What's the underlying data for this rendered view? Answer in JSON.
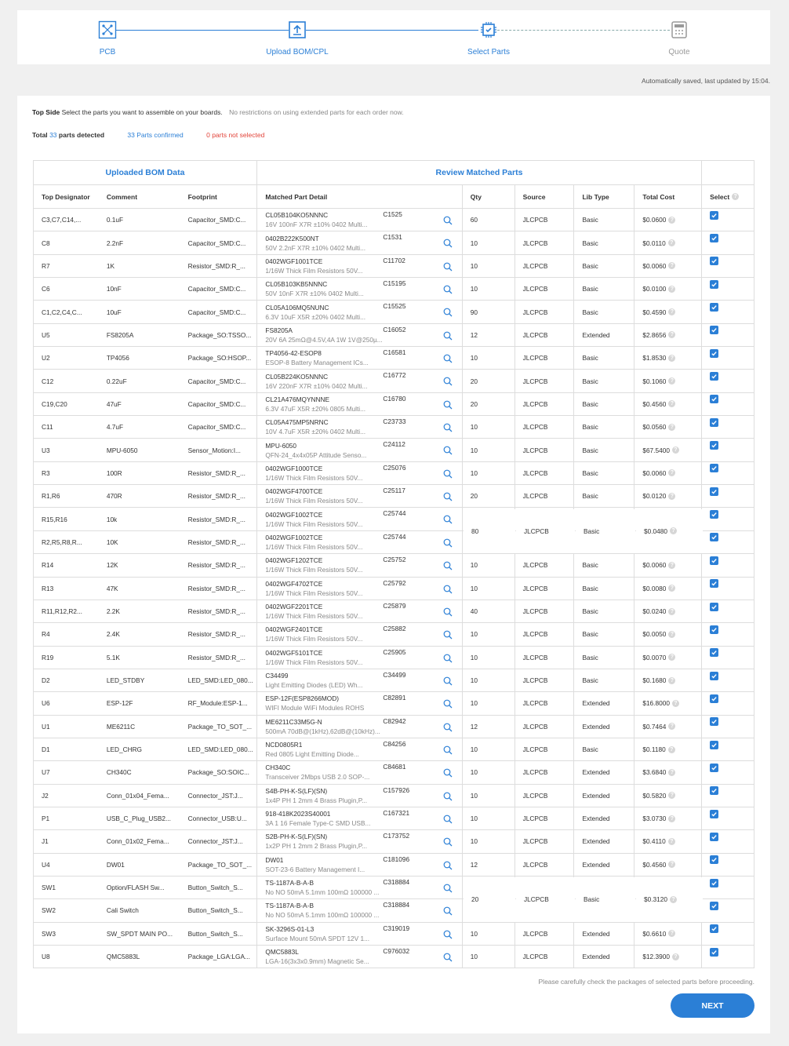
{
  "stepper": {
    "steps": [
      {
        "label": "PCB",
        "icon": "pcb-icon"
      },
      {
        "label": "Upload BOM/CPL",
        "icon": "upload-icon"
      },
      {
        "label": "Select Parts",
        "icon": "chip-icon"
      },
      {
        "label": "Quote",
        "icon": "calculator-icon"
      }
    ]
  },
  "autosave": "Automatically saved, last updated by 15:04.",
  "info": {
    "side": "Top Side",
    "instruction": "Select the parts you want to assemble on your boards.",
    "note": "No restrictions on using extended parts for each order now.",
    "total_prefix": "Total",
    "total_count": "33",
    "total_suffix": "parts detected",
    "confirmed": "33 Parts confirmed",
    "not_selected": "0 parts not selected"
  },
  "table": {
    "group_left": "Uploaded BOM Data",
    "group_right": "Review Matched Parts",
    "headers": {
      "designator": "Top Designator",
      "comment": "Comment",
      "footprint": "Footprint",
      "matched": "Matched Part Detail",
      "qty": "Qty",
      "source": "Source",
      "lib_type": "Lib Type",
      "total_cost": "Total Cost",
      "select": "Select"
    },
    "rows": [
      {
        "des": "C3,C7,C14,...",
        "comment": "0.1uF",
        "fp": "Capacitor_SMD:C...",
        "pn": "CL05B104KO5NNNC",
        "lcsc": "C1525",
        "desc": "16V 100nF X7R ±10% 0402 Multi...",
        "qty": "60",
        "source": "JLCPCB",
        "lib": "Basic",
        "cost": "$0.0600"
      },
      {
        "des": "C8",
        "comment": "2.2nF",
        "fp": "Capacitor_SMD:C...",
        "pn": "0402B222K500NT",
        "lcsc": "C1531",
        "desc": "50V 2.2nF X7R ±10% 0402 Multi...",
        "qty": "10",
        "source": "JLCPCB",
        "lib": "Basic",
        "cost": "$0.0110"
      },
      {
        "des": "R7",
        "comment": "1K",
        "fp": "Resistor_SMD:R_...",
        "pn": "0402WGF1001TCE",
        "lcsc": "C11702",
        "desc": "1/16W Thick Film Resistors 50V...",
        "qty": "10",
        "source": "JLCPCB",
        "lib": "Basic",
        "cost": "$0.0060"
      },
      {
        "des": "C6",
        "comment": "10nF",
        "fp": "Capacitor_SMD:C...",
        "pn": "CL05B103KB5NNNC",
        "lcsc": "C15195",
        "desc": "50V 10nF X7R ±10% 0402 Multi...",
        "qty": "10",
        "source": "JLCPCB",
        "lib": "Basic",
        "cost": "$0.0100"
      },
      {
        "des": "C1,C2,C4,C...",
        "comment": "10uF",
        "fp": "Capacitor_SMD:C...",
        "pn": "CL05A106MQ5NUNC",
        "lcsc": "C15525",
        "desc": "6.3V 10uF X5R ±20% 0402 Multi...",
        "qty": "90",
        "source": "JLCPCB",
        "lib": "Basic",
        "cost": "$0.4590"
      },
      {
        "des": "U5",
        "comment": "FS8205A",
        "fp": "Package_SO:TSSO...",
        "pn": "FS8205A",
        "lcsc": "C16052",
        "desc": "20V 6A 25mΩ@4.5V,4A 1W 1V@250µ...",
        "qty": "12",
        "source": "JLCPCB",
        "lib": "Extended",
        "cost": "$2.8656"
      },
      {
        "des": "U2",
        "comment": "TP4056",
        "fp": "Package_SO:HSOP...",
        "pn": "TP4056-42-ESOP8",
        "lcsc": "C16581",
        "desc": "ESOP-8 Battery Management ICs...",
        "qty": "10",
        "source": "JLCPCB",
        "lib": "Basic",
        "cost": "$1.8530"
      },
      {
        "des": "C12",
        "comment": "0.22uF",
        "fp": "Capacitor_SMD:C...",
        "pn": "CL05B224KO5NNNC",
        "lcsc": "C16772",
        "desc": "16V 220nF X7R ±10% 0402 Multi...",
        "qty": "20",
        "source": "JLCPCB",
        "lib": "Basic",
        "cost": "$0.1060"
      },
      {
        "des": "C19,C20",
        "comment": "47uF",
        "fp": "Capacitor_SMD:C...",
        "pn": "CL21A476MQYNNNE",
        "lcsc": "C16780",
        "desc": "6.3V 47uF X5R ±20% 0805 Multi...",
        "qty": "20",
        "source": "JLCPCB",
        "lib": "Basic",
        "cost": "$0.4560"
      },
      {
        "des": "C11",
        "comment": "4.7uF",
        "fp": "Capacitor_SMD:C...",
        "pn": "CL05A475MP5NRNC",
        "lcsc": "C23733",
        "desc": "10V 4.7uF X5R ±20% 0402 Multi...",
        "qty": "10",
        "source": "JLCPCB",
        "lib": "Basic",
        "cost": "$0.0560"
      },
      {
        "des": "U3",
        "comment": "MPU-6050",
        "fp": "Sensor_Motion:I...",
        "pn": "MPU-6050",
        "lcsc": "C24112",
        "desc": "QFN-24_4x4x05P Attitude Senso...",
        "qty": "10",
        "source": "JLCPCB",
        "lib": "Basic",
        "cost": "$67.5400"
      },
      {
        "des": "R3",
        "comment": "100R",
        "fp": "Resistor_SMD:R_...",
        "pn": "0402WGF1000TCE",
        "lcsc": "C25076",
        "desc": "1/16W Thick Film Resistors 50V...",
        "qty": "10",
        "source": "JLCPCB",
        "lib": "Basic",
        "cost": "$0.0060"
      },
      {
        "des": "R1,R6",
        "comment": "470R",
        "fp": "Resistor_SMD:R_...",
        "pn": "0402WGF4700TCE",
        "lcsc": "C25117",
        "desc": "1/16W Thick Film Resistors 50V...",
        "qty": "20",
        "source": "JLCPCB",
        "lib": "Basic",
        "cost": "$0.0120"
      },
      {
        "des": "R15,R16",
        "comment": "10k",
        "fp": "Resistor_SMD:R_...",
        "pn": "0402WGF1002TCE",
        "lcsc": "C25744",
        "desc": "1/16W Thick Film Resistors 50V...",
        "qty": "80",
        "source": "JLCPCB",
        "lib": "Basic",
        "cost": "$0.0480"
      },
      {
        "des": "R2,R5,R8,R...",
        "comment": "10K",
        "fp": "Resistor_SMD:R_...",
        "pn": "0402WGF1002TCE",
        "lcsc": "C25744",
        "desc": "1/16W Thick Film Resistors 50V...",
        "qty": "",
        "source": "",
        "lib": "",
        "cost": ""
      },
      {
        "des": "R14",
        "comment": "12K",
        "fp": "Resistor_SMD:R_...",
        "pn": "0402WGF1202TCE",
        "lcsc": "C25752",
        "desc": "1/16W Thick Film Resistors 50V...",
        "qty": "10",
        "source": "JLCPCB",
        "lib": "Basic",
        "cost": "$0.0060"
      },
      {
        "des": "R13",
        "comment": "47K",
        "fp": "Resistor_SMD:R_...",
        "pn": "0402WGF4702TCE",
        "lcsc": "C25792",
        "desc": "1/16W Thick Film Resistors 50V...",
        "qty": "10",
        "source": "JLCPCB",
        "lib": "Basic",
        "cost": "$0.0080"
      },
      {
        "des": "R11,R12,R2...",
        "comment": "2.2K",
        "fp": "Resistor_SMD:R_...",
        "pn": "0402WGF2201TCE",
        "lcsc": "C25879",
        "desc": "1/16W Thick Film Resistors 50V...",
        "qty": "40",
        "source": "JLCPCB",
        "lib": "Basic",
        "cost": "$0.0240"
      },
      {
        "des": "R4",
        "comment": "2.4K",
        "fp": "Resistor_SMD:R_...",
        "pn": "0402WGF2401TCE",
        "lcsc": "C25882",
        "desc": "1/16W Thick Film Resistors 50V...",
        "qty": "10",
        "source": "JLCPCB",
        "lib": "Basic",
        "cost": "$0.0050"
      },
      {
        "des": "R19",
        "comment": "5.1K",
        "fp": "Resistor_SMD:R_...",
        "pn": "0402WGF5101TCE",
        "lcsc": "C25905",
        "desc": "1/16W Thick Film Resistors 50V...",
        "qty": "10",
        "source": "JLCPCB",
        "lib": "Basic",
        "cost": "$0.0070"
      },
      {
        "des": "D2",
        "comment": "LED_STDBY",
        "fp": "LED_SMD:LED_080...",
        "pn": "C34499",
        "lcsc": "C34499",
        "desc": "Light Emitting Diodes (LED) Wh...",
        "qty": "10",
        "source": "JLCPCB",
        "lib": "Basic",
        "cost": "$0.1680"
      },
      {
        "des": "U6",
        "comment": "ESP-12F",
        "fp": "RF_Module:ESP-1...",
        "pn": "ESP-12F(ESP8266MOD)",
        "lcsc": "C82891",
        "desc": "WIFI Module WiFi Modules ROHS",
        "qty": "10",
        "source": "JLCPCB",
        "lib": "Extended",
        "cost": "$16.8000"
      },
      {
        "des": "U1",
        "comment": "ME6211C",
        "fp": "Package_TO_SOT_...",
        "pn": "ME6211C33M5G-N",
        "lcsc": "C82942",
        "desc": "500mA 70dB@(1kHz),62dB@(10kHz)...",
        "qty": "12",
        "source": "JLCPCB",
        "lib": "Extended",
        "cost": "$0.7464"
      },
      {
        "des": "D1",
        "comment": "LED_CHRG",
        "fp": "LED_SMD:LED_080...",
        "pn": "NCD0805R1",
        "lcsc": "C84256",
        "desc": "Red 0805 Light Emitting Diode...",
        "qty": "10",
        "source": "JLCPCB",
        "lib": "Basic",
        "cost": "$0.1180"
      },
      {
        "des": "U7",
        "comment": "CH340C",
        "fp": "Package_SO:SOIC...",
        "pn": "CH340C",
        "lcsc": "C84681",
        "desc": "Transceiver 2Mbps USB 2.0 SOP-...",
        "qty": "10",
        "source": "JLCPCB",
        "lib": "Extended",
        "cost": "$3.6840"
      },
      {
        "des": "J2",
        "comment": "Conn_01x04_Fema...",
        "fp": "Connector_JST:J...",
        "pn": "S4B-PH-K-S(LF)(SN)",
        "lcsc": "C157926",
        "desc": "1x4P PH 1 2mm 4 Brass Plugin,P...",
        "qty": "10",
        "source": "JLCPCB",
        "lib": "Extended",
        "cost": "$0.5820"
      },
      {
        "des": "P1",
        "comment": "USB_C_Plug_USB2...",
        "fp": "Connector_USB:U...",
        "pn": "918-418K2023S40001",
        "lcsc": "C167321",
        "desc": "3A 1 16 Female Type-C SMD USB...",
        "qty": "10",
        "source": "JLCPCB",
        "lib": "Extended",
        "cost": "$3.0730"
      },
      {
        "des": "J1",
        "comment": "Conn_01x02_Fema...",
        "fp": "Connector_JST:J...",
        "pn": "S2B-PH-K-S(LF)(SN)",
        "lcsc": "C173752",
        "desc": "1x2P PH 1 2mm 2 Brass Plugin,P...",
        "qty": "10",
        "source": "JLCPCB",
        "lib": "Extended",
        "cost": "$0.4110"
      },
      {
        "des": "U4",
        "comment": "DW01",
        "fp": "Package_TO_SOT_...",
        "pn": "DW01",
        "lcsc": "C181096",
        "desc": "SOT-23-6 Battery Management I...",
        "qty": "12",
        "source": "JLCPCB",
        "lib": "Extended",
        "cost": "$0.4560"
      },
      {
        "des": "SW1",
        "comment": "Option/FLASH Sw...",
        "fp": "Button_Switch_S...",
        "pn": "TS-1187A-B-A-B",
        "lcsc": "C318884",
        "desc": "No NO 50mA 5.1mm 100mΩ 100000 ...",
        "qty": "20",
        "source": "JLCPCB",
        "lib": "Basic",
        "cost": "$0.3120"
      },
      {
        "des": "SW2",
        "comment": "Cali Switch",
        "fp": "Button_Switch_S...",
        "pn": "TS-1187A-B-A-B",
        "lcsc": "C318884",
        "desc": "No NO 50mA 5.1mm 100mΩ 100000 ...",
        "qty": "",
        "source": "",
        "lib": "",
        "cost": ""
      },
      {
        "des": "SW3",
        "comment": "SW_SPDT MAIN PO...",
        "fp": "Button_Switch_S...",
        "pn": "SK-3296S-01-L3",
        "lcsc": "C319019",
        "desc": "Surface Mount 50mA SPDT 12V 1...",
        "qty": "10",
        "source": "JLCPCB",
        "lib": "Extended",
        "cost": "$0.6610"
      },
      {
        "des": "U8",
        "comment": "QMC5883L",
        "fp": "Package_LGA:LGA...",
        "pn": "QMC5883L",
        "lcsc": "C976032",
        "desc": "LGA-16(3x3x0.9mm) Magnetic Se...",
        "qty": "10",
        "source": "JLCPCB",
        "lib": "Extended",
        "cost": "$12.3900"
      }
    ]
  },
  "footnote": "Please carefully check the packages of selected parts before proceeding.",
  "next_label": "NEXT",
  "colors": {
    "accent": "#2b7fd6",
    "danger": "#e2443a"
  }
}
